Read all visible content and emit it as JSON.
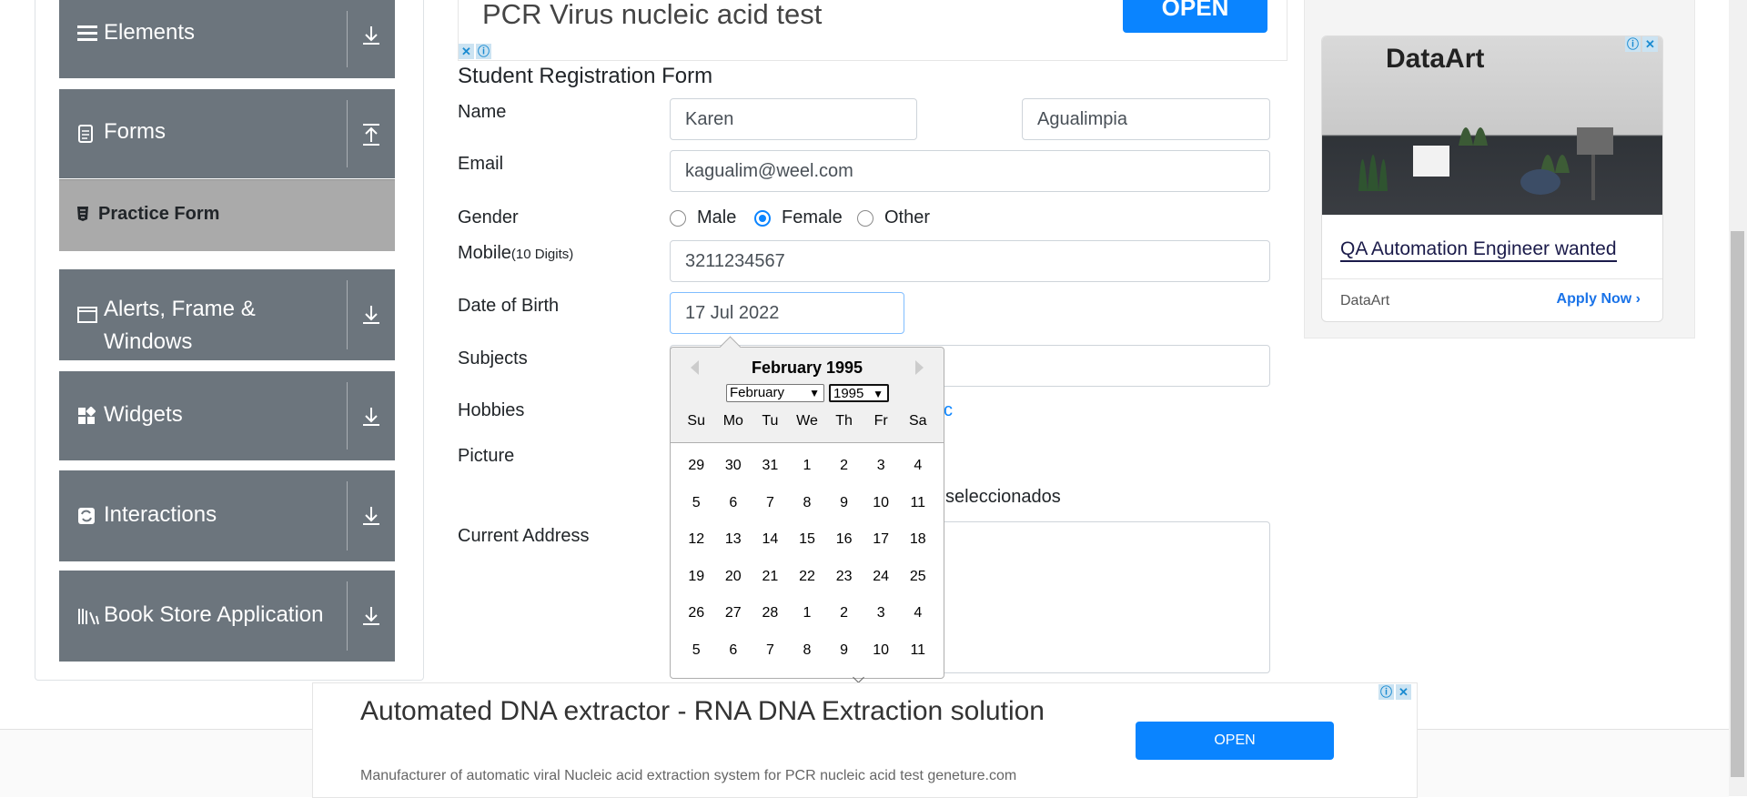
{
  "sidebar": {
    "groups": [
      {
        "label": "Elements",
        "icon": "hamburger-icon",
        "arrow": "download-arrow-icon"
      },
      {
        "label": "Forms",
        "icon": "document-icon",
        "arrow": "upload-arrow-icon"
      },
      {
        "label": "Alerts, Frame & Windows",
        "icon": "window-icon",
        "arrow": "download-arrow-icon"
      },
      {
        "label": "Widgets",
        "icon": "widgets-icon",
        "arrow": "download-arrow-icon"
      },
      {
        "label": "Interactions",
        "icon": "interactions-icon",
        "arrow": "download-arrow-icon"
      },
      {
        "label": "Book Store Application",
        "icon": "books-icon",
        "arrow": "download-arrow-icon"
      }
    ],
    "active_item": "Practice Form"
  },
  "top_ad": {
    "title": "PCR Virus nucleic acid test",
    "button": "OPEN"
  },
  "form": {
    "title": "Student Registration Form",
    "labels": {
      "name": "Name",
      "email": "Email",
      "gender": "Gender",
      "mobile": "Mobile",
      "mobile_hint": "(10 Digits)",
      "dob": "Date of Birth",
      "subjects": "Subjects",
      "hobbies": "Hobbies",
      "picture": "Picture",
      "address": "Current Address"
    },
    "first_name": "Karen",
    "last_name": "Agualimpia",
    "email": "kagualim@weel.com",
    "gender_options": [
      "Male",
      "Female",
      "Other"
    ],
    "gender_selected": "Female",
    "mobile": "3211234567",
    "dob": "17 Jul 2022",
    "hobbies_peek": "c",
    "picture_peek": "seleccionados"
  },
  "datepicker": {
    "title": "February 1995",
    "month_select": "February",
    "year_select": "1995",
    "weekdays": [
      "Su",
      "Mo",
      "Tu",
      "We",
      "Th",
      "Fr",
      "Sa"
    ],
    "weeks": [
      [
        "29",
        "30",
        "31",
        "1",
        "2",
        "3",
        "4"
      ],
      [
        "5",
        "6",
        "7",
        "8",
        "9",
        "10",
        "11"
      ],
      [
        "12",
        "13",
        "14",
        "15",
        "16",
        "17",
        "18"
      ],
      [
        "19",
        "20",
        "21",
        "22",
        "23",
        "24",
        "25"
      ],
      [
        "26",
        "27",
        "28",
        "1",
        "2",
        "3",
        "4"
      ],
      [
        "5",
        "6",
        "7",
        "8",
        "9",
        "10",
        "11"
      ]
    ]
  },
  "side_ad": {
    "logo": "DataArt",
    "headline": "QA Automation Engineer wanted",
    "brand": "DataArt",
    "cta": "Apply Now"
  },
  "bottom_ad": {
    "title": "Automated DNA extractor - RNA DNA Extraction solution",
    "description": "Manufacturer of automatic viral Nucleic acid extraction system for PCR nucleic acid test geneture.com",
    "button": "OPEN"
  },
  "colors": {
    "accent": "#0a84ff",
    "sidebar": "#6c757d",
    "active": "#aaaaaa"
  }
}
